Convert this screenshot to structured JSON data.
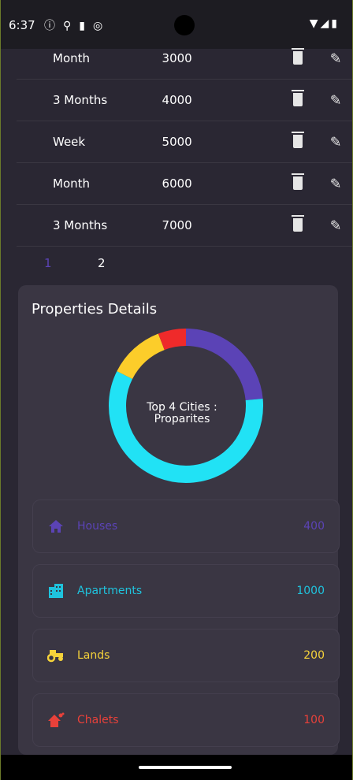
{
  "status_bar": {
    "time": "6:37",
    "left_icons": [
      "info-icon",
      "usb-icon",
      "sd-card-icon",
      "sync-icon"
    ],
    "right_icons": [
      "wifi-icon",
      "signal-icon",
      "battery-icon"
    ]
  },
  "table": {
    "rows": [
      {
        "period": "Month",
        "amount": "3000"
      },
      {
        "period": "3 Months",
        "amount": "4000"
      },
      {
        "period": "Week",
        "amount": "5000"
      },
      {
        "period": "Month",
        "amount": "6000"
      },
      {
        "period": "3 Months",
        "amount": "7000"
      }
    ]
  },
  "pagination": {
    "pages": [
      "1",
      "2"
    ],
    "active_page": "1"
  },
  "properties": {
    "title": "Properties Details",
    "chart_label_line1": "Top 4 Cities :",
    "chart_label_line2": "Proparites",
    "items": [
      {
        "label": "Houses",
        "value": "400",
        "color": "#5b43b6",
        "icon": "house-icon"
      },
      {
        "label": "Apartments",
        "value": "1000",
        "color": "#1fc3dd",
        "icon": "apartment-icon"
      },
      {
        "label": "Lands",
        "value": "200",
        "color": "#f6d33a",
        "icon": "tractor-icon"
      },
      {
        "label": "Chalets",
        "value": "100",
        "color": "#e8413a",
        "icon": "chalet-icon"
      }
    ]
  },
  "chart_data": {
    "type": "pie",
    "title": "Top 4 Cities : Proparites",
    "categories": [
      "Houses",
      "Apartments",
      "Lands",
      "Chalets"
    ],
    "values": [
      400,
      1000,
      200,
      100
    ],
    "colors": [
      "#5b43b6",
      "#21e2f5",
      "#fccd2a",
      "#ef2a2a"
    ],
    "donut": true
  }
}
